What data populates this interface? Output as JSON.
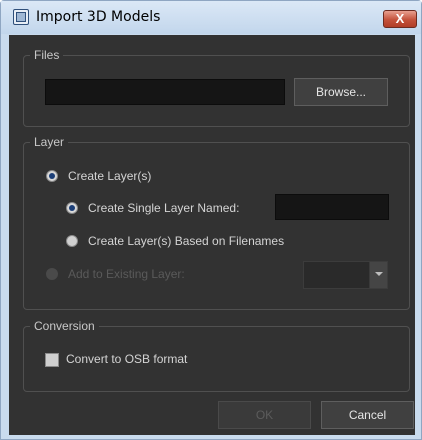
{
  "window": {
    "title": "Import 3D Models",
    "close_glyph": "X"
  },
  "files": {
    "group_label": "Files",
    "path_value": "",
    "browse_label": "Browse..."
  },
  "layer": {
    "group_label": "Layer",
    "create_layers_label": "Create Layer(s)",
    "create_layers_selected": true,
    "single_layer_label": "Create Single Layer Named:",
    "single_layer_selected": true,
    "single_layer_name_value": "",
    "based_on_filenames_label": "Create Layer(s) Based on Filenames",
    "based_on_filenames_selected": false,
    "add_existing_label": "Add to Existing Layer:",
    "add_existing_selected": false,
    "add_existing_enabled": false,
    "existing_layer_value": ""
  },
  "conversion": {
    "group_label": "Conversion",
    "osb_label": "Convert to OSB format",
    "osb_checked": false
  },
  "footer": {
    "ok_label": "OK",
    "ok_enabled": false,
    "cancel_label": "Cancel"
  },
  "colors": {
    "dialog_bg": "#323232",
    "field_bg": "#151515",
    "text": "#d4d4d4",
    "disabled_text": "#5a5a5a",
    "radio_dot": "#1c3f78",
    "titlebar": "#c9dbee",
    "close_button": "#c4523b"
  },
  "icons": {
    "app": "application-window-icon",
    "close": "close-icon",
    "dropdown": "chevron-down-icon"
  }
}
